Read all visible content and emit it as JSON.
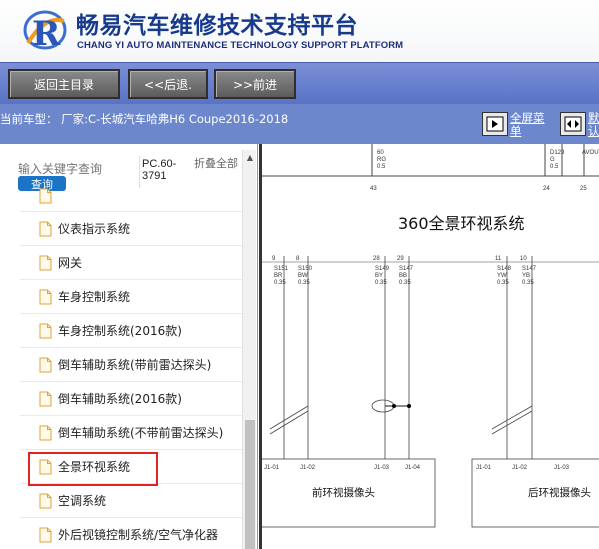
{
  "header": {
    "brand_cn": "畅易汽车维修技术支持平台",
    "brand_en": "CHANG YI AUTO MAINTENANCE TECHNOLOGY SUPPORT PLATFORM",
    "brand_color": "#173a8c"
  },
  "nav": {
    "home": "返回主目录",
    "back": "<<后退.",
    "forward": ">>前进"
  },
  "model_bar": {
    "text": "当前车型： 厂家:C-长城汽车哈弗H6 Coupe2016-2018",
    "fullscreen_label": "全屏菜单",
    "split_label": "默认"
  },
  "search": {
    "placeholder": "输入关键字查询",
    "button": "查询",
    "pc_code": "PC.60-3791",
    "collapse_all": "折叠全部"
  },
  "tree": {
    "items": [
      {
        "label": "",
        "partial": true
      },
      {
        "label": "仪表指示系统"
      },
      {
        "label": "网关"
      },
      {
        "label": "车身控制系统"
      },
      {
        "label": "车身控制系统(2016款)"
      },
      {
        "label": "倒车辅助系统(带前雷达探头)"
      },
      {
        "label": "倒车辅助系统(2016款)"
      },
      {
        "label": "倒车辅助系统(不带前雷达探头)"
      },
      {
        "label": "全景环视系统",
        "selected": true
      },
      {
        "label": "空调系统"
      },
      {
        "label": "外后视镜控制系统/空气净化器"
      }
    ]
  },
  "diagram": {
    "title": "360全景环视系统",
    "front_camera": "前环视摄像头",
    "rear_camera": "后环视摄像头",
    "top_pins": [
      "43",
      "24",
      "25"
    ],
    "top_wires": [
      "60\nRG\n0.5",
      "D129\nG\n0.5",
      "AVOUT-3"
    ],
    "pin_numbers": [
      "9",
      "8",
      "28",
      "29",
      "11",
      "10"
    ],
    "wire_codes": [
      "S151\nBR\n0.35",
      "S150\nBW\n0.35",
      "S149\nBY\n0.35",
      "S147\nBB\n0.35",
      "S148\nYW\n0.35",
      "S147\nYB\n0.35"
    ],
    "connector_pins": [
      "J1-01",
      "J1-02",
      "J1-03",
      "J1-04",
      "J1-01",
      "J1-02",
      "J1-03"
    ]
  }
}
